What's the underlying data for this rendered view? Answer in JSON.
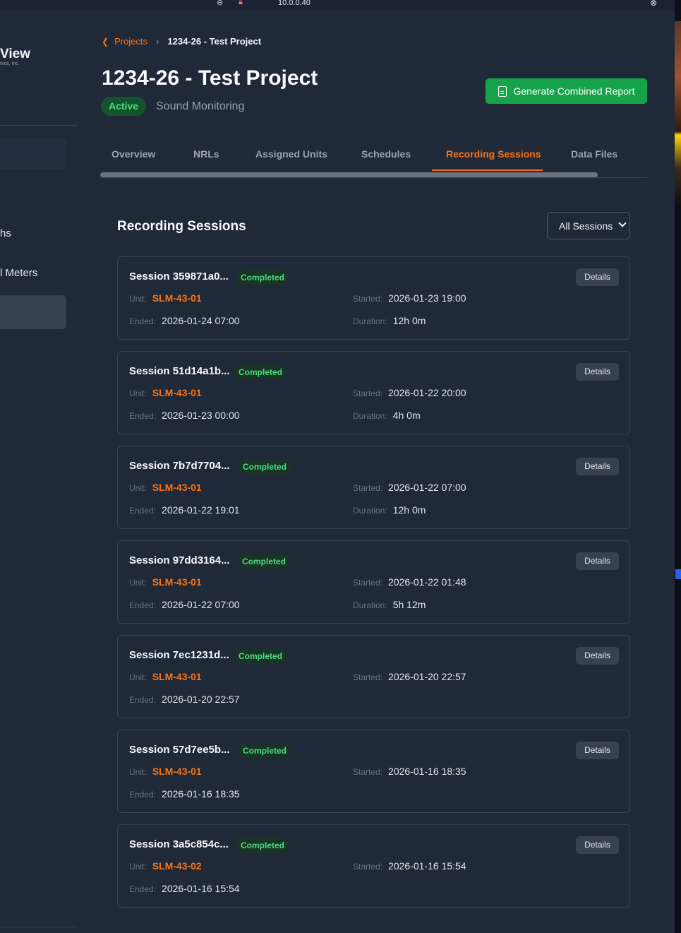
{
  "topbar": {
    "ip": "10.0.0.40"
  },
  "sidebar": {
    "brand": "View",
    "brand_sub": "nics, Inc.",
    "nav": [
      {
        "label": "hs"
      },
      {
        "label": "l Meters"
      }
    ]
  },
  "breadcrumb": {
    "parent": "Projects",
    "current": "1234-26 - Test Project"
  },
  "project": {
    "title": "1234-26 - Test Project",
    "status": "Active",
    "type": "Sound Monitoring"
  },
  "actions": {
    "generate_report": "Generate Combined Report"
  },
  "tabs": [
    {
      "label": "Overview"
    },
    {
      "label": "NRLs"
    },
    {
      "label": "Assigned Units"
    },
    {
      "label": "Schedules"
    },
    {
      "label": "Recording Sessions",
      "active": true
    },
    {
      "label": "Data Files"
    }
  ],
  "section": {
    "title": "Recording Sessions",
    "filter_value": "All Sessions"
  },
  "labels": {
    "unit": "Unit:",
    "started": "Started:",
    "ended": "Ended:",
    "duration": "Duration:",
    "details": "Details"
  },
  "sessions": [
    {
      "title": "Session 359871a0...",
      "status": "Completed",
      "unit": "SLM-43-01",
      "started": "2026-01-23 19:00",
      "ended": "2026-01-24 07:00",
      "duration": "12h 0m"
    },
    {
      "title": "Session 51d14a1b...",
      "status": "Completed",
      "unit": "SLM-43-01",
      "started": "2026-01-22 20:00",
      "ended": "2026-01-23 00:00",
      "duration": "4h 0m"
    },
    {
      "title": "Session 7b7d7704...",
      "status": "Completed",
      "unit": "SLM-43-01",
      "started": "2026-01-22 07:00",
      "ended": "2026-01-22 19:01",
      "duration": "12h 0m"
    },
    {
      "title": "Session 97dd3164...",
      "status": "Completed",
      "unit": "SLM-43-01",
      "started": "2026-01-22 01:48",
      "ended": "2026-01-22 07:00",
      "duration": "5h 12m"
    },
    {
      "title": "Session 7ec1231d...",
      "status": "Completed",
      "unit": "SLM-43-01",
      "started": "2026-01-20 22:57",
      "ended": "2026-01-20 22:57"
    },
    {
      "title": "Session 57d7ee5b...",
      "status": "Completed",
      "unit": "SLM-43-01",
      "started": "2026-01-16 18:35",
      "ended": "2026-01-16 18:35"
    },
    {
      "title": "Session 3a5c854c...",
      "status": "Completed",
      "unit": "SLM-43-02",
      "started": "2026-01-16 15:54",
      "ended": "2026-01-16 15:54"
    }
  ],
  "colors": {
    "accent": "#f97316",
    "success": "#16a34a",
    "success_text": "#4ade80",
    "background": "#1f2937"
  }
}
